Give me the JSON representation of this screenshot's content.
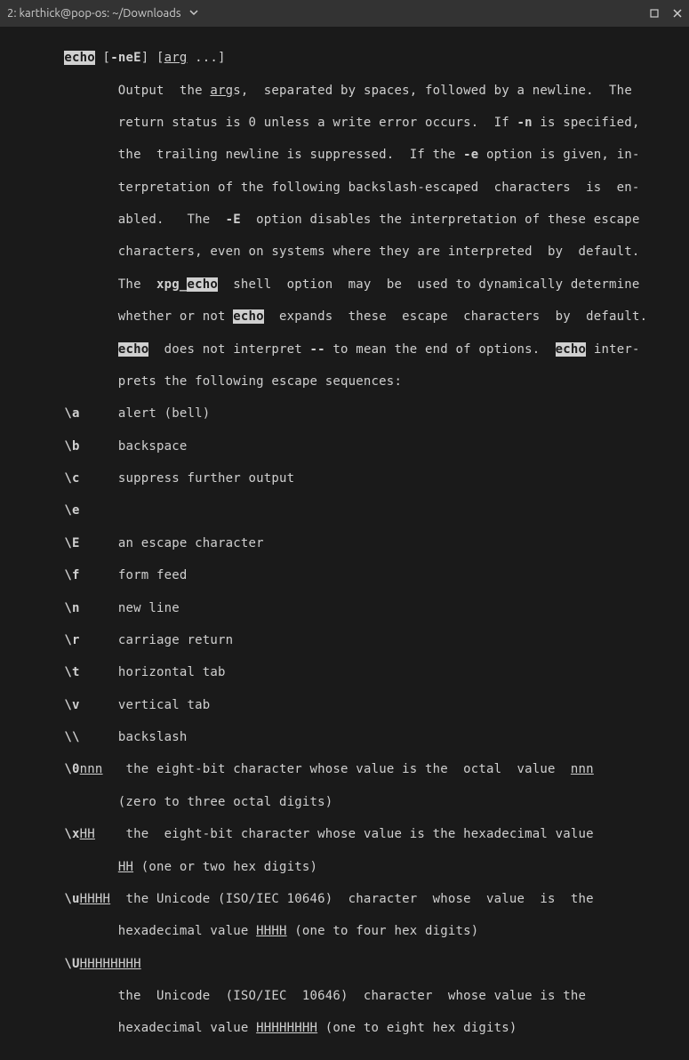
{
  "titlebar": {
    "title": "2: karthick@pop-os: ~/Downloads"
  },
  "man": {
    "header": {
      "echo": "echo",
      "opts": "-neE",
      "arg_u": "arg"
    },
    "desc": {
      "l1a": "       Output  the ",
      "l1_arg": "arg",
      "l1b": "s,  separated by spaces, followed by a newline.  The",
      "l2a": "       return status is 0 unless a write error occurs.  If ",
      "l2_n": "-n",
      "l2b": " is specified,",
      "l3a": "       the  trailing newline is suppressed.  If the ",
      "l3_e": "-e",
      "l3b": " option is given, in-",
      "l4": "       terpretation of the following backslash-escaped  characters  is  en-",
      "l5a": "       abled.   The  ",
      "l5_E": "-E",
      "l5b": "  option disables the interpretation of these escape",
      "l6": "       characters, even on systems where they are interpreted  by  default.",
      "l7a": "       The  ",
      "l7_x": "xpg_",
      "l7_e": "echo",
      "l7b": "  shell  option  may  be  used to dynamically determine",
      "l8a": "       whether or not ",
      "l8_e": "echo",
      "l8b": "  expands  these  escape  characters  by  default.",
      "l9a": "       ",
      "l9_e": "echo",
      "l9b": "  does not interpret ",
      "l9_dash": "--",
      "l9c": " to mean the end of options.  ",
      "l9_e2": "echo",
      "l9d": " inter-",
      "l10": "       prets the following escape sequences:"
    },
    "esc": {
      "a": {
        "k": "\\a",
        "v": "     alert (bell)"
      },
      "b": {
        "k": "\\b",
        "v": "     backspace"
      },
      "c": {
        "k": "\\c",
        "v": "     suppress further output"
      },
      "e": {
        "k": "\\e",
        "v": ""
      },
      "E": {
        "k": "\\E",
        "v": "     an escape character"
      },
      "f": {
        "k": "\\f",
        "v": "     form feed"
      },
      "n": {
        "k": "\\n",
        "v": "     new line"
      },
      "r": {
        "k": "\\r",
        "v": "     carriage return"
      },
      "t": {
        "k": "\\t",
        "v": "     horizontal tab"
      },
      "v": {
        "k": "\\v",
        "v": "     vertical tab"
      },
      "bs": {
        "k": "\\\\",
        "v": "     backslash"
      },
      "o0": {
        "k": "\\0",
        "u": "nnn",
        "mid": "   the eight-bit character whose value is the  octal  value  ",
        "u2": "nnn"
      },
      "o0b": "              (zero to three octal digits)",
      "xH": {
        "k": "\\x",
        "u": "HH",
        "v": "    the  eight-bit character whose value is the hexadecimal value"
      },
      "xHb": {
        "pre": "              ",
        "u": "HH",
        "post": " (one or two hex digits)"
      },
      "uH": {
        "k": "\\u",
        "u": "HHHH",
        "v": "  the Unicode (ISO/IEC 10646)  character  whose  value  is  the"
      },
      "uHb": {
        "pre": "              hexadecimal value ",
        "u": "HHHH",
        "post": " (one to four hex digits)"
      },
      "UH": {
        "k": "\\U",
        "u": "HHHHHHHH"
      },
      "UH2": "              the  Unicode  (ISO/IEC  10646)  character  whose value is the",
      "UH3": {
        "pre": "              hexadecimal value ",
        "u": "HHHHHHHH",
        "post": " (one to eight hex digits)"
      }
    }
  }
}
